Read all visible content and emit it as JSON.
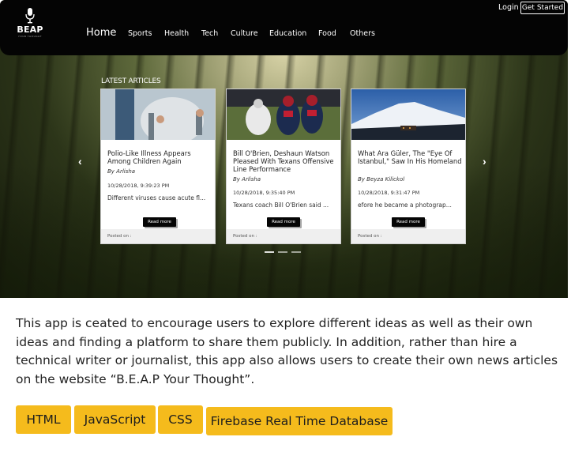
{
  "nav": {
    "logo_text": "BEAP",
    "logo_sub": "YOUR THOUGHT",
    "home": "Home",
    "items": [
      "Sports",
      "Health",
      "Tech",
      "Culture",
      "Education",
      "Food",
      "Others"
    ],
    "login": "Login",
    "get_started": "Get Started"
  },
  "carousel": {
    "heading": "LATEST ARTICLES",
    "prev": "‹",
    "next": "›",
    "articles": [
      {
        "title": "Polio-Like Illness Appears Among Children Again",
        "author": "By Arlisha",
        "date": "10/28/2018, 9:39:23 PM",
        "snippet": "Different viruses cause acute fl...",
        "read_more": "Read more",
        "posted_on": "Posted on :"
      },
      {
        "title": "Bill O'Brien, Deshaun Watson Pleased With Texans Offensive Line Performance",
        "author": "By Arlisha",
        "date": "10/28/2018, 9:35:40 PM",
        "snippet": "Texans coach Bill O'Brien said ...",
        "read_more": "Read more",
        "posted_on": "Posted on :"
      },
      {
        "title": "What Ara Güler, The \"Eye Of Istanbul,\" Saw In His Homeland",
        "author": "By Beyza Kilickol",
        "date": "10/28/2018, 9:31:47 PM",
        "snippet": "efore he became a photograp...",
        "read_more": "Read more",
        "posted_on": "Posted on :"
      }
    ]
  },
  "description": "This app is ceated to encourage users to explore different ideas as well as their own ideas and finding a platform to share them publicly. In addition, rather than hire a technical writer or journalist, this app also allows users to create their own news articles on the website “B.E.A.P Your Thought”.",
  "tags": [
    "HTML",
    "JavaScript",
    "CSS",
    "Firebase Real Time Database"
  ],
  "colors": {
    "navbar": "#040404",
    "tag_bg": "#f5bb1c",
    "text": "#222222"
  }
}
